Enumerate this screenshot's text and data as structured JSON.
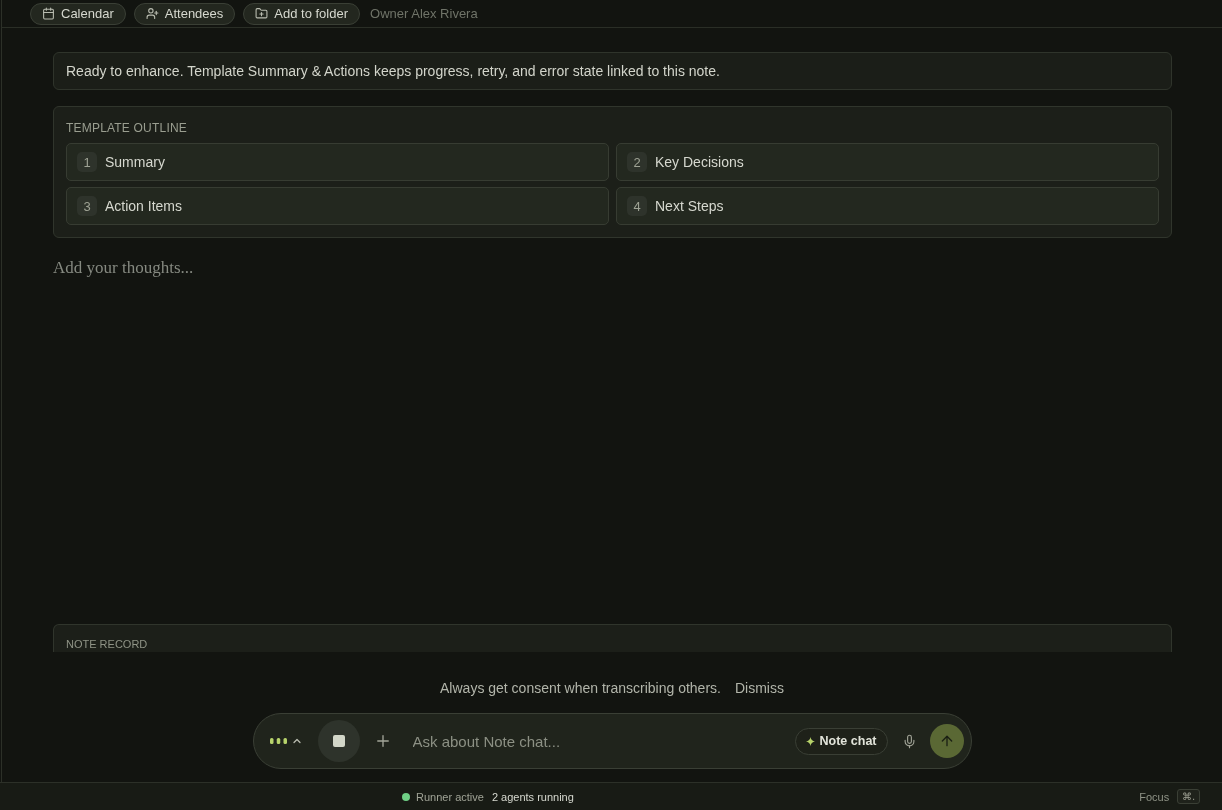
{
  "header": {
    "chips": [
      {
        "kind": "calendar",
        "label": "Calendar"
      },
      {
        "kind": "attendees",
        "label": "Attendees"
      },
      {
        "kind": "folder",
        "label": "Add to folder"
      }
    ],
    "owner": "Owner Alex Rivera"
  },
  "banner": {
    "text": "Ready to enhance. Template Summary & Actions keeps progress, retry, and error state linked to this note."
  },
  "outline": {
    "title": "TEMPLATE OUTLINE",
    "sections": [
      {
        "number": "1",
        "label": "Summary"
      },
      {
        "number": "2",
        "label": "Key Decisions"
      },
      {
        "number": "3",
        "label": "Action Items"
      },
      {
        "number": "4",
        "label": "Next Steps"
      }
    ]
  },
  "editor": {
    "placeholder": "Add your thoughts..."
  },
  "note_record": {
    "title": "NOTE RECORD"
  },
  "consent": {
    "text": "Always get consent when transcribing others.",
    "dismiss": "Dismiss"
  },
  "composer": {
    "placeholder": "Ask about Note chat...",
    "scope_chip": "Note chat"
  },
  "status_bar": {
    "runner": "Runner active",
    "runner_active": true,
    "agents": "2 agents running",
    "focus": "Focus",
    "shortcut": "⌘."
  }
}
